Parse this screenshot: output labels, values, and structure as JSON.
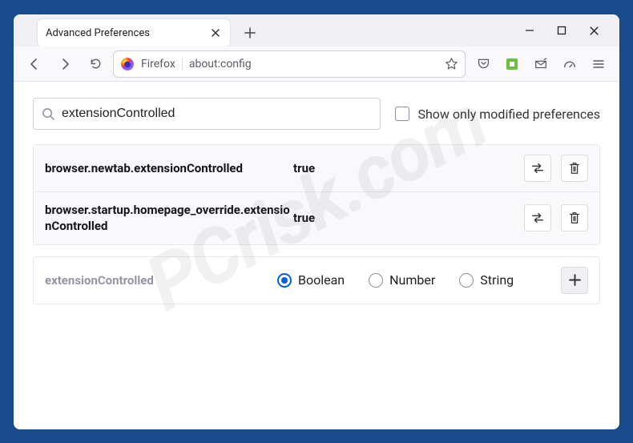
{
  "window": {
    "tab_title": "Advanced Preferences",
    "url_identity": "Firefox",
    "url": "about:config"
  },
  "search": {
    "value": "extensionControlled",
    "checkbox_label": "Show only modified preferences"
  },
  "preferences": [
    {
      "name": "browser.newtab.extensionControlled",
      "value": "true"
    },
    {
      "name": "browser.startup.homepage_override.extensionControlled",
      "value": "true"
    }
  ],
  "create": {
    "name": "extensionControlled",
    "options": [
      "Boolean",
      "Number",
      "String"
    ],
    "selected": "Boolean"
  },
  "watermark": "PCrisk.com"
}
